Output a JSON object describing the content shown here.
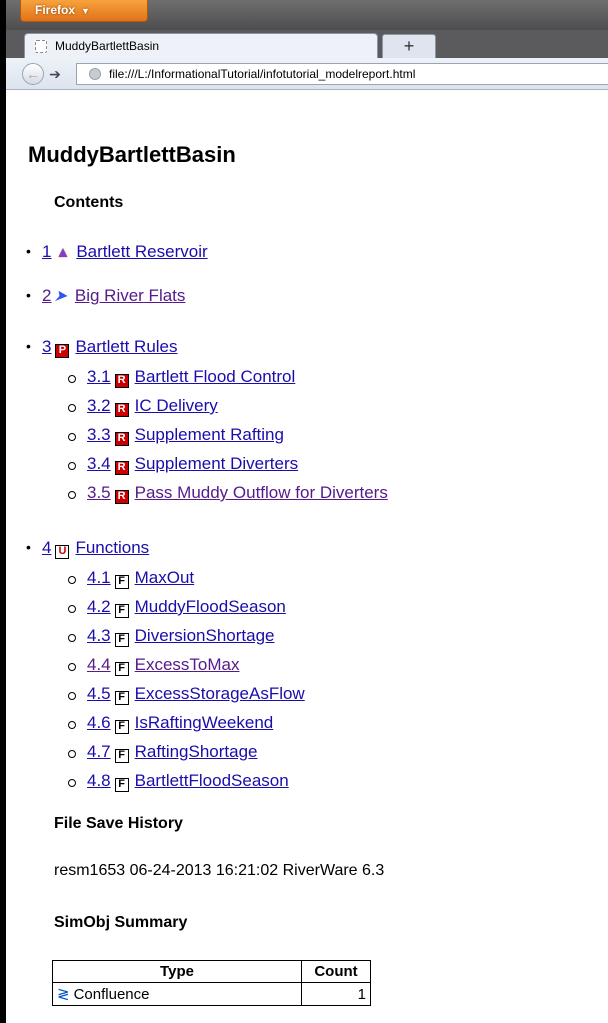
{
  "browser": {
    "menu_label": "Firefox",
    "tab_title": "MuddyBartlettBasin",
    "new_tab": "+",
    "url": "file:///L:/InformationalTutorial/infotutorial_modelreport.html"
  },
  "page": {
    "title": "MuddyBartlettBasin",
    "contents_heading": "Contents",
    "toc": [
      {
        "num": "1",
        "icon": "reservoir-icon",
        "label": "Bartlett Reservoir"
      },
      {
        "num": "2",
        "icon": "reach-icon",
        "label": "Big River Flats"
      },
      {
        "num": "3",
        "icon": "policy-icon",
        "label": "Bartlett Rules",
        "children": [
          {
            "num": "3.1",
            "label": "Bartlett Flood Control"
          },
          {
            "num": "3.2",
            "label": "IC Delivery"
          },
          {
            "num": "3.3",
            "label": "Supplement Rafting"
          },
          {
            "num": "3.4",
            "label": "Supplement Diverters"
          },
          {
            "num": "3.5",
            "label": "Pass Muddy Outflow for Diverters"
          }
        ]
      },
      {
        "num": "4",
        "icon": "utility-icon",
        "label": "Functions",
        "children": [
          {
            "num": "4.1",
            "label": "MaxOut"
          },
          {
            "num": "4.2",
            "label": "MuddyFloodSeason"
          },
          {
            "num": "4.3",
            "label": "DiversionShortage"
          },
          {
            "num": "4.4",
            "label": "ExcessToMax"
          },
          {
            "num": "4.5",
            "label": "ExcessStorageAsFlow"
          },
          {
            "num": "4.6",
            "label": "IsRaftingWeekend"
          },
          {
            "num": "4.7",
            "label": "RaftingShortage"
          },
          {
            "num": "4.8",
            "label": "BartlettFloodSeason"
          }
        ]
      }
    ],
    "icon_letters": {
      "policy": "P",
      "rule": "R",
      "utility": "U",
      "function": "F"
    },
    "file_save_heading": "File Save History",
    "file_save_entry": "resm1653 06-24-2013 16:21:02 RiverWare 6.3",
    "simobj_heading": "SimObj Summary",
    "summary_table": {
      "headers": [
        "Type",
        "Count"
      ],
      "rows": [
        {
          "type": "Confluence",
          "count": "1"
        }
      ]
    }
  }
}
